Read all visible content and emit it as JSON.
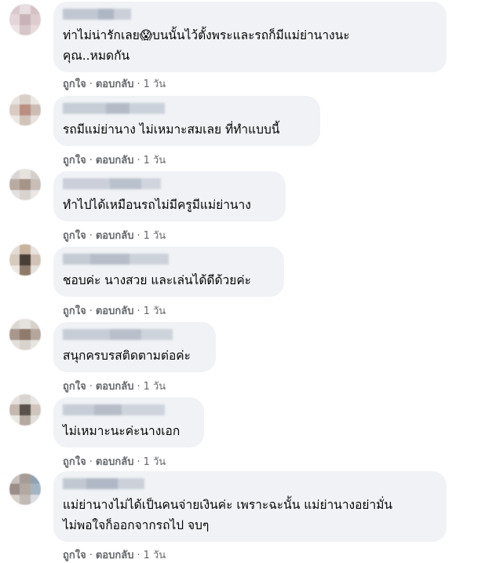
{
  "actions": {
    "like_label": "ถูกใจ",
    "reply_label": "ตอบกลับ",
    "time": "1 วัน"
  },
  "comments": [
    {
      "text": "ท่าไม่น่ารักเลย😱บนนั้นไว้ตั้งพระและรถก็มีแม่ย่านางนะ\nคุณ..หมดกัน"
    },
    {
      "text": "รถมีแม่ย่านาง ไม่เหมาะสมเลย ที่ทำแบบนี้"
    },
    {
      "text": "ทำไปได้เหมือนรถไม่มีครูมีแม่ย่านาง"
    },
    {
      "text": "ชอบค่ะ นางสวย และเล่นได้ดีด้วยค่ะ"
    },
    {
      "text": "สนุกครบรสติดตามต่อค่ะ"
    },
    {
      "text": "ไม่เหมาะนะค่ะนางเอก"
    },
    {
      "text": "แม่ย่านางไม่ได้เป็นคนจ่ายเงินค่ะ เพราะฉะนั้น แม่ย่านางอย่ามั่น\nไม่พอใจก็ออกจากรถไป จบๆ"
    }
  ]
}
